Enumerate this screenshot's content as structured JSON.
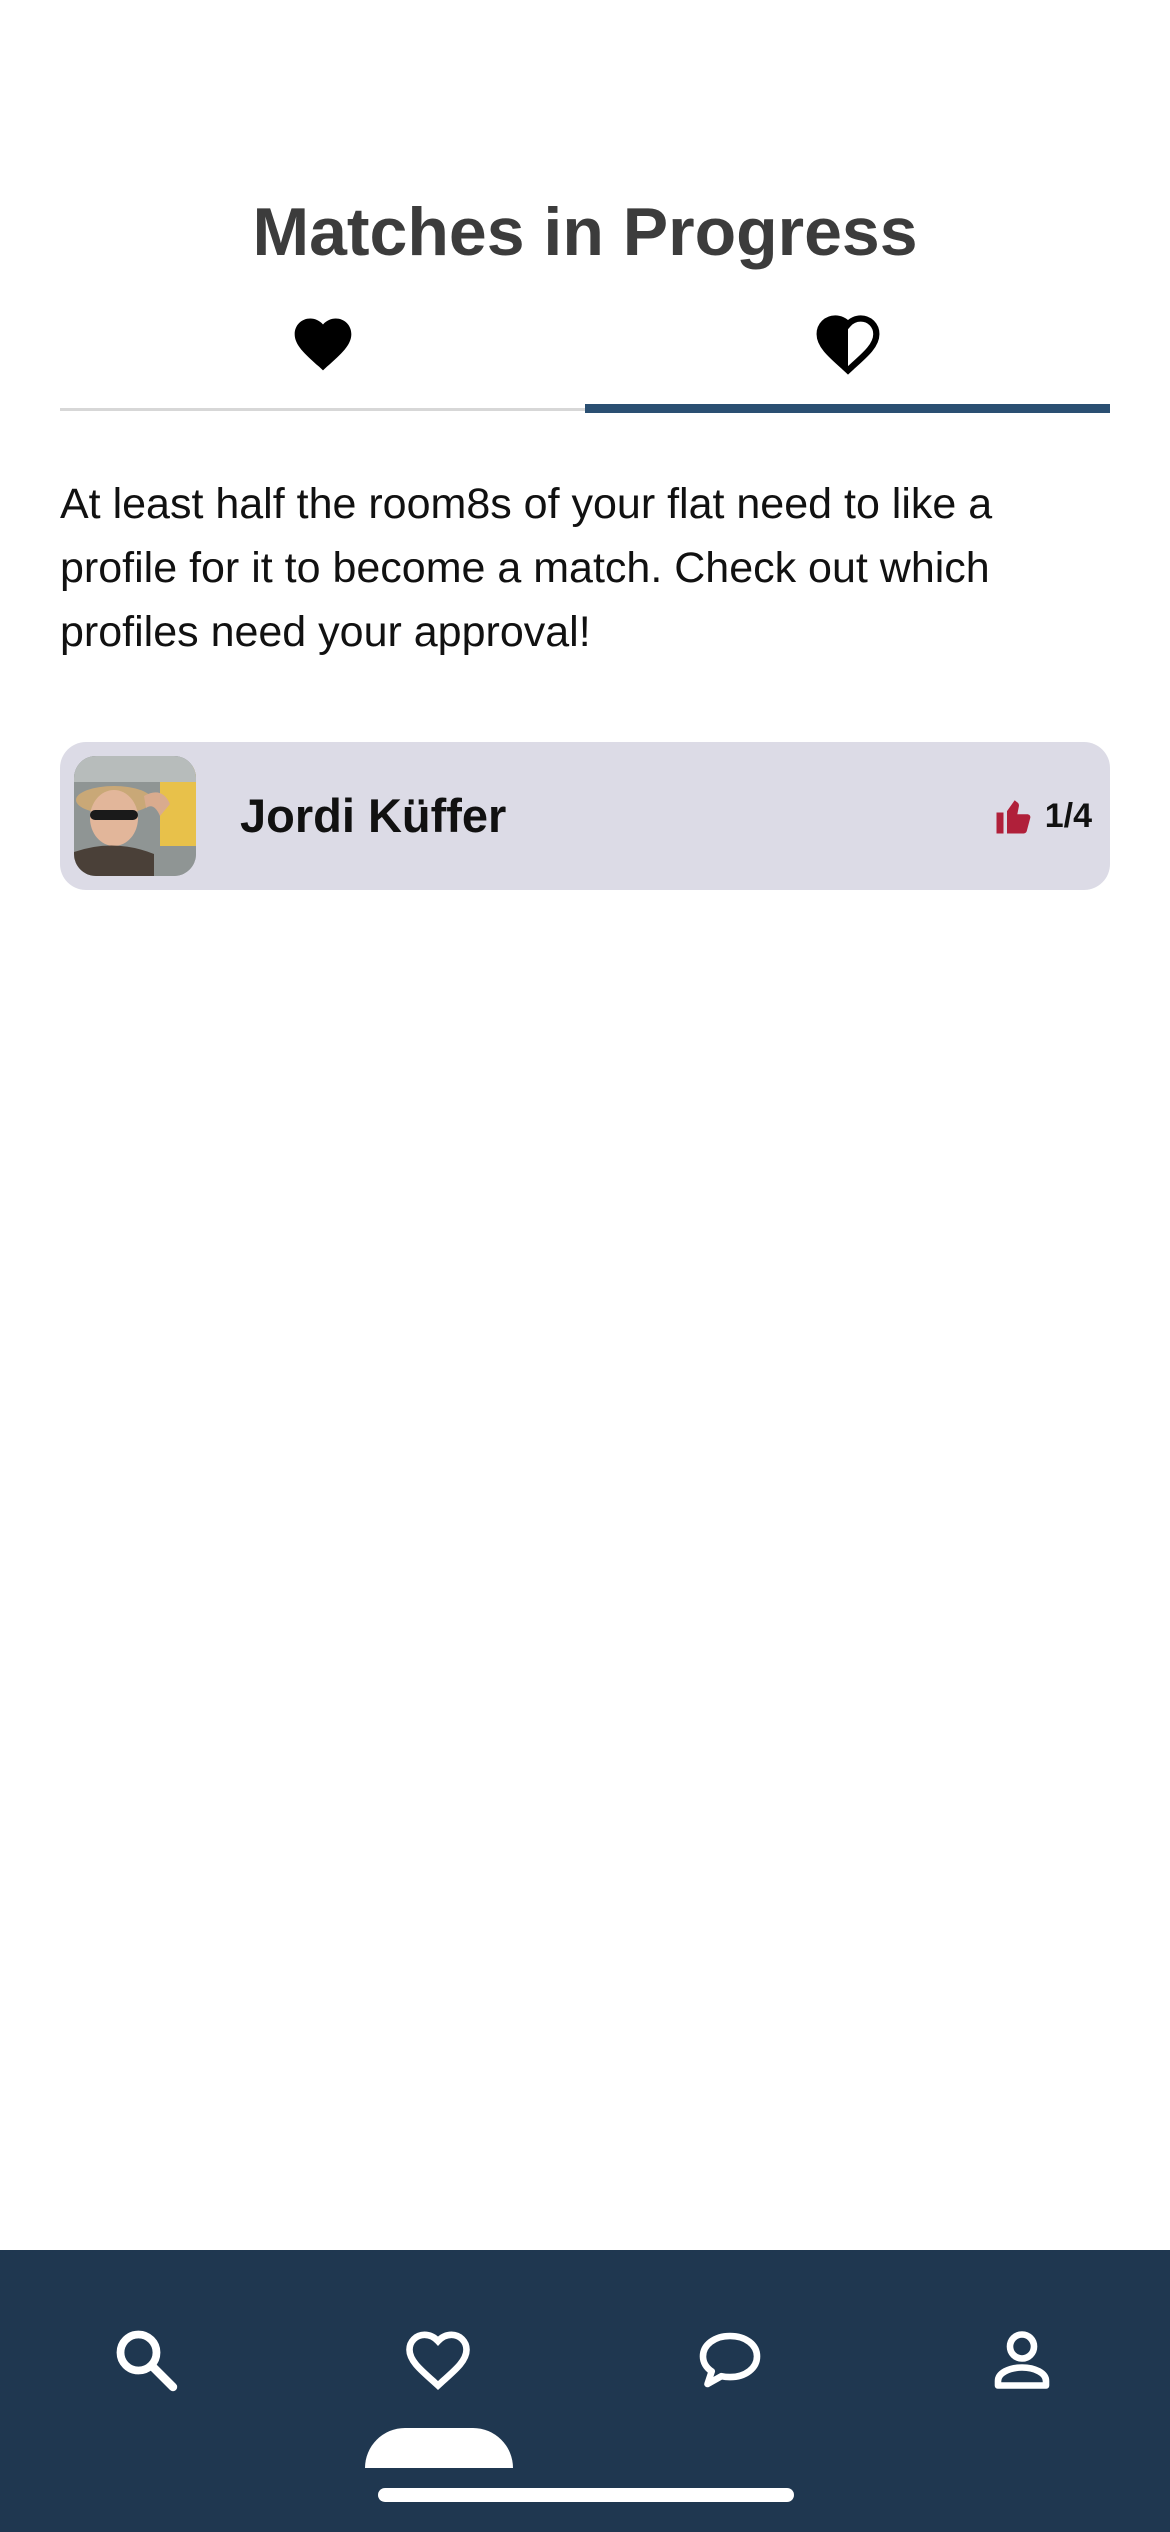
{
  "page": {
    "title": "Matches in Progress",
    "description": "At least half the room8s of your flat need to like a profile for it to become a match. Check out which profiles need your approval!"
  },
  "tabs": [
    {
      "icon": "heart-filled-icon",
      "active": false
    },
    {
      "icon": "heart-half-icon",
      "active": true
    }
  ],
  "matches": [
    {
      "name": "Jordi Küffer",
      "approvals": "1/4",
      "approval_icon": "thumbs-up-icon"
    }
  ],
  "navbar": {
    "items": [
      {
        "icon": "search-icon"
      },
      {
        "icon": "heart-outline-icon",
        "active": true
      },
      {
        "icon": "chat-bubble-icon"
      },
      {
        "icon": "person-icon"
      }
    ]
  },
  "colors": {
    "accent": "#2a4f72",
    "navbar": "#1f3750",
    "card": "#dcdbe6",
    "thumbs": "#b0203a",
    "title": "#3c3c3c"
  }
}
